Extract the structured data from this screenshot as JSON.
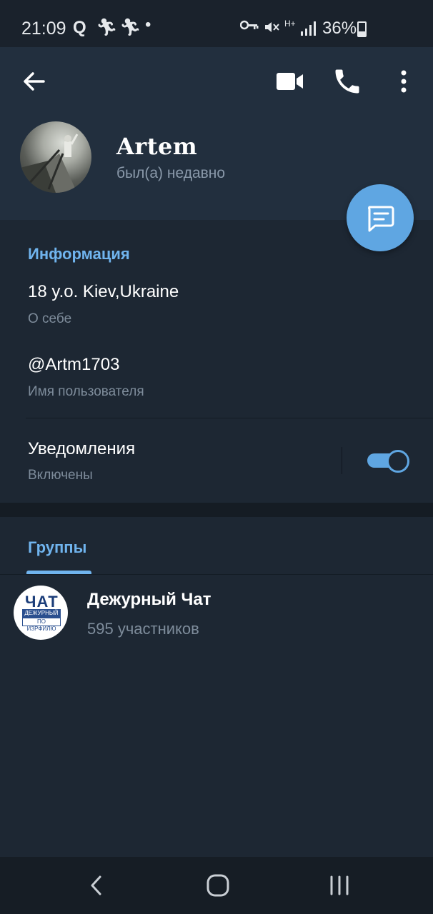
{
  "status_bar": {
    "time": "21:09",
    "battery": "36%",
    "network": "H+",
    "left_icons": [
      "q-icon",
      "runner-icon",
      "runner-icon",
      "dot-icon"
    ],
    "right_icons": [
      "key-icon",
      "mute-icon",
      "network-icon",
      "signal-icon",
      "battery-icon"
    ]
  },
  "header": {
    "name": "Artem",
    "last_seen": "был(а) недавно",
    "actions": [
      "back-arrow-icon",
      "video-call-icon",
      "phone-icon",
      "more-vert-icon"
    ]
  },
  "info": {
    "title": "Информация",
    "bio_value": "18 y.o. Kiev,Ukraine",
    "bio_label": "О себе",
    "username_value": "@Artm1703",
    "username_label": "Имя пользователя",
    "notifications_title": "Уведомления",
    "notifications_status": "Включены",
    "notifications_enabled": true
  },
  "groups": {
    "tab_label": "Группы",
    "items": [
      {
        "name": "Дежурный Чат",
        "members": "595 участников",
        "avatar_title": "ЧАТ",
        "avatar_line1": "ДЕЖУРНЫЙ",
        "avatar_line2": "ПО ИЗРФИЛЮ"
      }
    ]
  },
  "colors": {
    "accent": "#70b4ee",
    "fab": "#5fa6e2",
    "header_bg": "#222f3e",
    "body_bg": "#1d2733"
  }
}
